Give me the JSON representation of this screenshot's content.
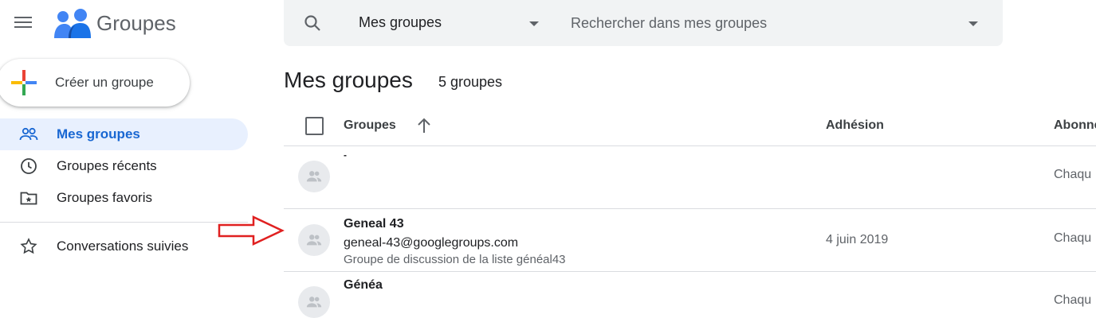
{
  "app": {
    "title": "Groupes"
  },
  "sidebar": {
    "create_label": "Créer un groupe",
    "items": [
      {
        "label": "Mes groupes",
        "icon": "people-icon",
        "active": true
      },
      {
        "label": "Groupes récents",
        "icon": "clock-icon"
      },
      {
        "label": "Groupes favoris",
        "icon": "star-folder-icon"
      },
      {
        "label": "Conversations suivies",
        "icon": "star-icon"
      }
    ]
  },
  "search": {
    "scope": "Mes groupes",
    "placeholder": "Rechercher dans mes groupes"
  },
  "main": {
    "title": "Mes groupes",
    "count": "5 groupes",
    "columns": {
      "groups": "Groupes",
      "joined": "Adhésion",
      "subscription": "Abonne"
    },
    "rows": [
      {
        "name": "-",
        "email": "",
        "description": "",
        "joined": "",
        "subscription": "Chaqu"
      },
      {
        "name": "Geneal 43",
        "email": "geneal-43@googlegroups.com",
        "description": "Groupe de discussion de la liste généal43",
        "joined": "4 juin 2019",
        "subscription": "Chaqu"
      },
      {
        "name": "Généa",
        "email": "",
        "description": "",
        "joined": "",
        "subscription": "Chaqu"
      }
    ]
  },
  "colors": {
    "accent": "#1967d2",
    "active_bg": "#e8f0fe",
    "arrow": "#e02020"
  }
}
